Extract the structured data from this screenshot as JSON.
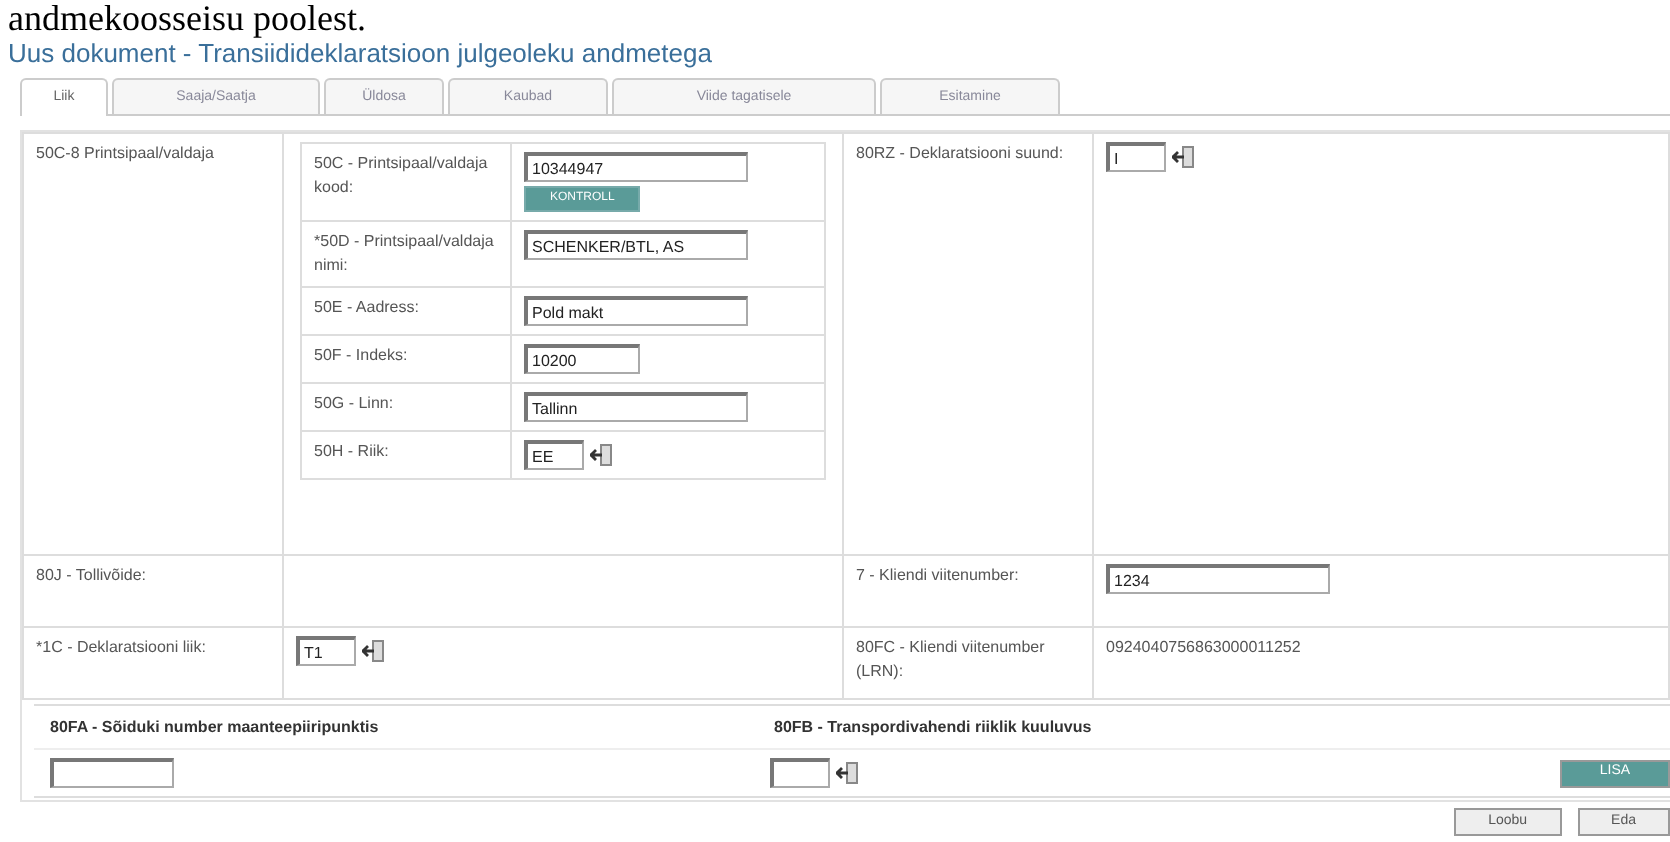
{
  "heading": "andmekoosseisu poolest.",
  "subtitle": "Uus dokument - Transiidideklaratsioon julgeoleku andmetega",
  "tabs": [
    {
      "label": "Liik",
      "selected": true
    },
    {
      "label": "Saaja/Saatja",
      "selected": false
    },
    {
      "label": "Üldosa",
      "selected": false
    },
    {
      "label": "Kaubad",
      "selected": false
    },
    {
      "label": "Viide tagatisele",
      "selected": false
    },
    {
      "label": "Esitamine",
      "selected": false
    }
  ],
  "principal": {
    "label": "50C-8 Printsipaal/valdaja",
    "fields": [
      {
        "label": "50C - Printsipaal/valdaja kood:",
        "value": "10344947",
        "kind": "wide",
        "button": "KONTROLL"
      },
      {
        "label": "*50D - Printsipaal/valdaja nimi:",
        "value": "SCHENKER/BTL, AS",
        "kind": "wide"
      },
      {
        "label": "50E - Aadress:",
        "value": "Pold makt",
        "kind": "wide"
      },
      {
        "label": "50F - Indeks:",
        "value": "10200",
        "kind": "medium"
      },
      {
        "label": "50G - Linn:",
        "value": "Tallinn",
        "kind": "wide"
      },
      {
        "label": "50H - Riik:",
        "value": "EE",
        "kind": "lookup"
      }
    ]
  },
  "direction": {
    "label": "80RZ - Deklaratsiooni suund:",
    "value": "I",
    "kind": "lookup"
  },
  "rows": [
    {
      "label": "80J - Tollivõide:",
      "right_label": "7 - Kliendi viitenumber:",
      "right_value": "1234",
      "kind": "input"
    },
    {
      "label": "*1C - Deklaratsiooni liik:",
      "value": "T1",
      "right_label": "80FC - Kliendi viitenumber (LRN):",
      "right_value": "0924040756863000011252",
      "kind": "text"
    }
  ],
  "vehicle": {
    "label": "80FA - Sõiduki number maanteepiiripunktis"
  },
  "nationality": {
    "label": "80FB - Transpordivahendi riiklik kuuluvus"
  },
  "add_button": "LISA",
  "footer_buttons": [
    "Loobu",
    "Eda"
  ]
}
